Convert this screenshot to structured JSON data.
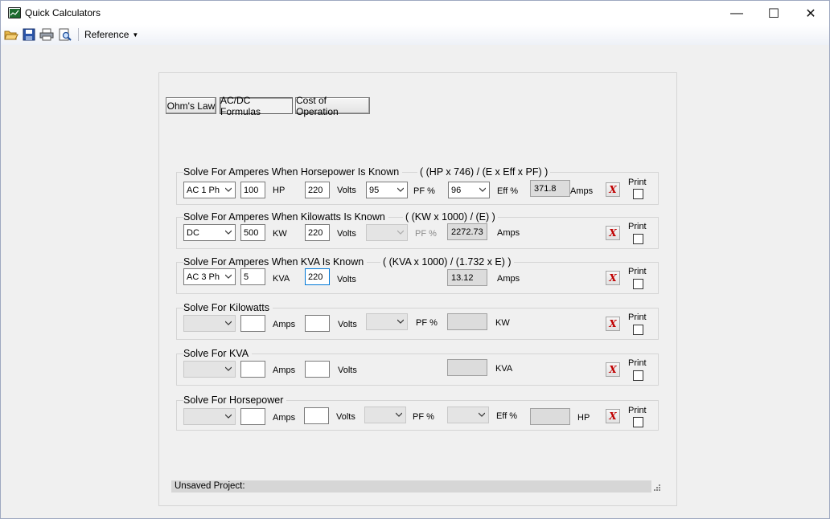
{
  "window": {
    "title": "Quick Calculators",
    "minimize_glyph": "—",
    "maximize_glyph": "☐",
    "close_glyph": "✕"
  },
  "toolbar": {
    "icons": [
      "open-folder-icon",
      "save-icon",
      "print-icon",
      "print-preview-icon"
    ],
    "reference_label": "Reference",
    "reference_caret": "▼"
  },
  "tabs": [
    {
      "label": "Ohm's Law",
      "active": false
    },
    {
      "label": "AC/DC Formulas",
      "active": true
    },
    {
      "label": "Cost of Operation",
      "active": false
    }
  ],
  "print_label": "Print",
  "clear_glyph": "X",
  "groups": {
    "hp_amps": {
      "title": "Solve For Amperes When Horsepower Is Known",
      "formula": "( (HP x 746) / (E x Eff x PF) )",
      "phase": "AC 1 Ph",
      "input1_value": "100",
      "input1_unit": "HP",
      "volts_value": "220",
      "volts_unit": "Volts",
      "pf_value": "95",
      "pf_unit": "PF %",
      "eff_value": "96",
      "eff_unit": "Eff %",
      "result": "371.8",
      "result_unit": "Amps"
    },
    "kw_amps": {
      "title": "Solve For Amperes When Kilowatts Is Known",
      "formula": "( (KW x 1000) / (E) )",
      "phase": "DC",
      "input1_value": "500",
      "input1_unit": "KW",
      "volts_value": "220",
      "volts_unit": "Volts",
      "pf_value": "",
      "pf_unit": "PF %",
      "result": "2272.73",
      "result_unit": "Amps"
    },
    "kva_amps": {
      "title": "Solve For Amperes When KVA Is Known",
      "formula": "( (KVA x 1000) / (1.732 x E) )",
      "phase": "AC 3 Ph",
      "input1_value": "5",
      "input1_unit": "KVA",
      "volts_value": "220",
      "volts_unit": "Volts",
      "result": "13.12",
      "result_unit": "Amps"
    },
    "kw": {
      "title": "Solve For Kilowatts",
      "phase": "",
      "input1_value": "",
      "input1_unit": "Amps",
      "volts_value": "",
      "volts_unit": "Volts",
      "pf_value": "",
      "pf_unit": "PF %",
      "result": "",
      "result_unit": "KW"
    },
    "kva": {
      "title": "Solve For KVA",
      "phase": "",
      "input1_value": "",
      "input1_unit": "Amps",
      "volts_value": "",
      "volts_unit": "Volts",
      "result": "",
      "result_unit": "KVA"
    },
    "hp": {
      "title": "Solve For Horsepower",
      "phase": "",
      "input1_value": "",
      "input1_unit": "Amps",
      "volts_value": "",
      "volts_unit": "Volts",
      "pf_value": "",
      "pf_unit": "PF %",
      "eff_value": "",
      "eff_unit": "Eff %",
      "result": "",
      "result_unit": "HP"
    }
  },
  "status": {
    "text": "Unsaved Project:"
  }
}
